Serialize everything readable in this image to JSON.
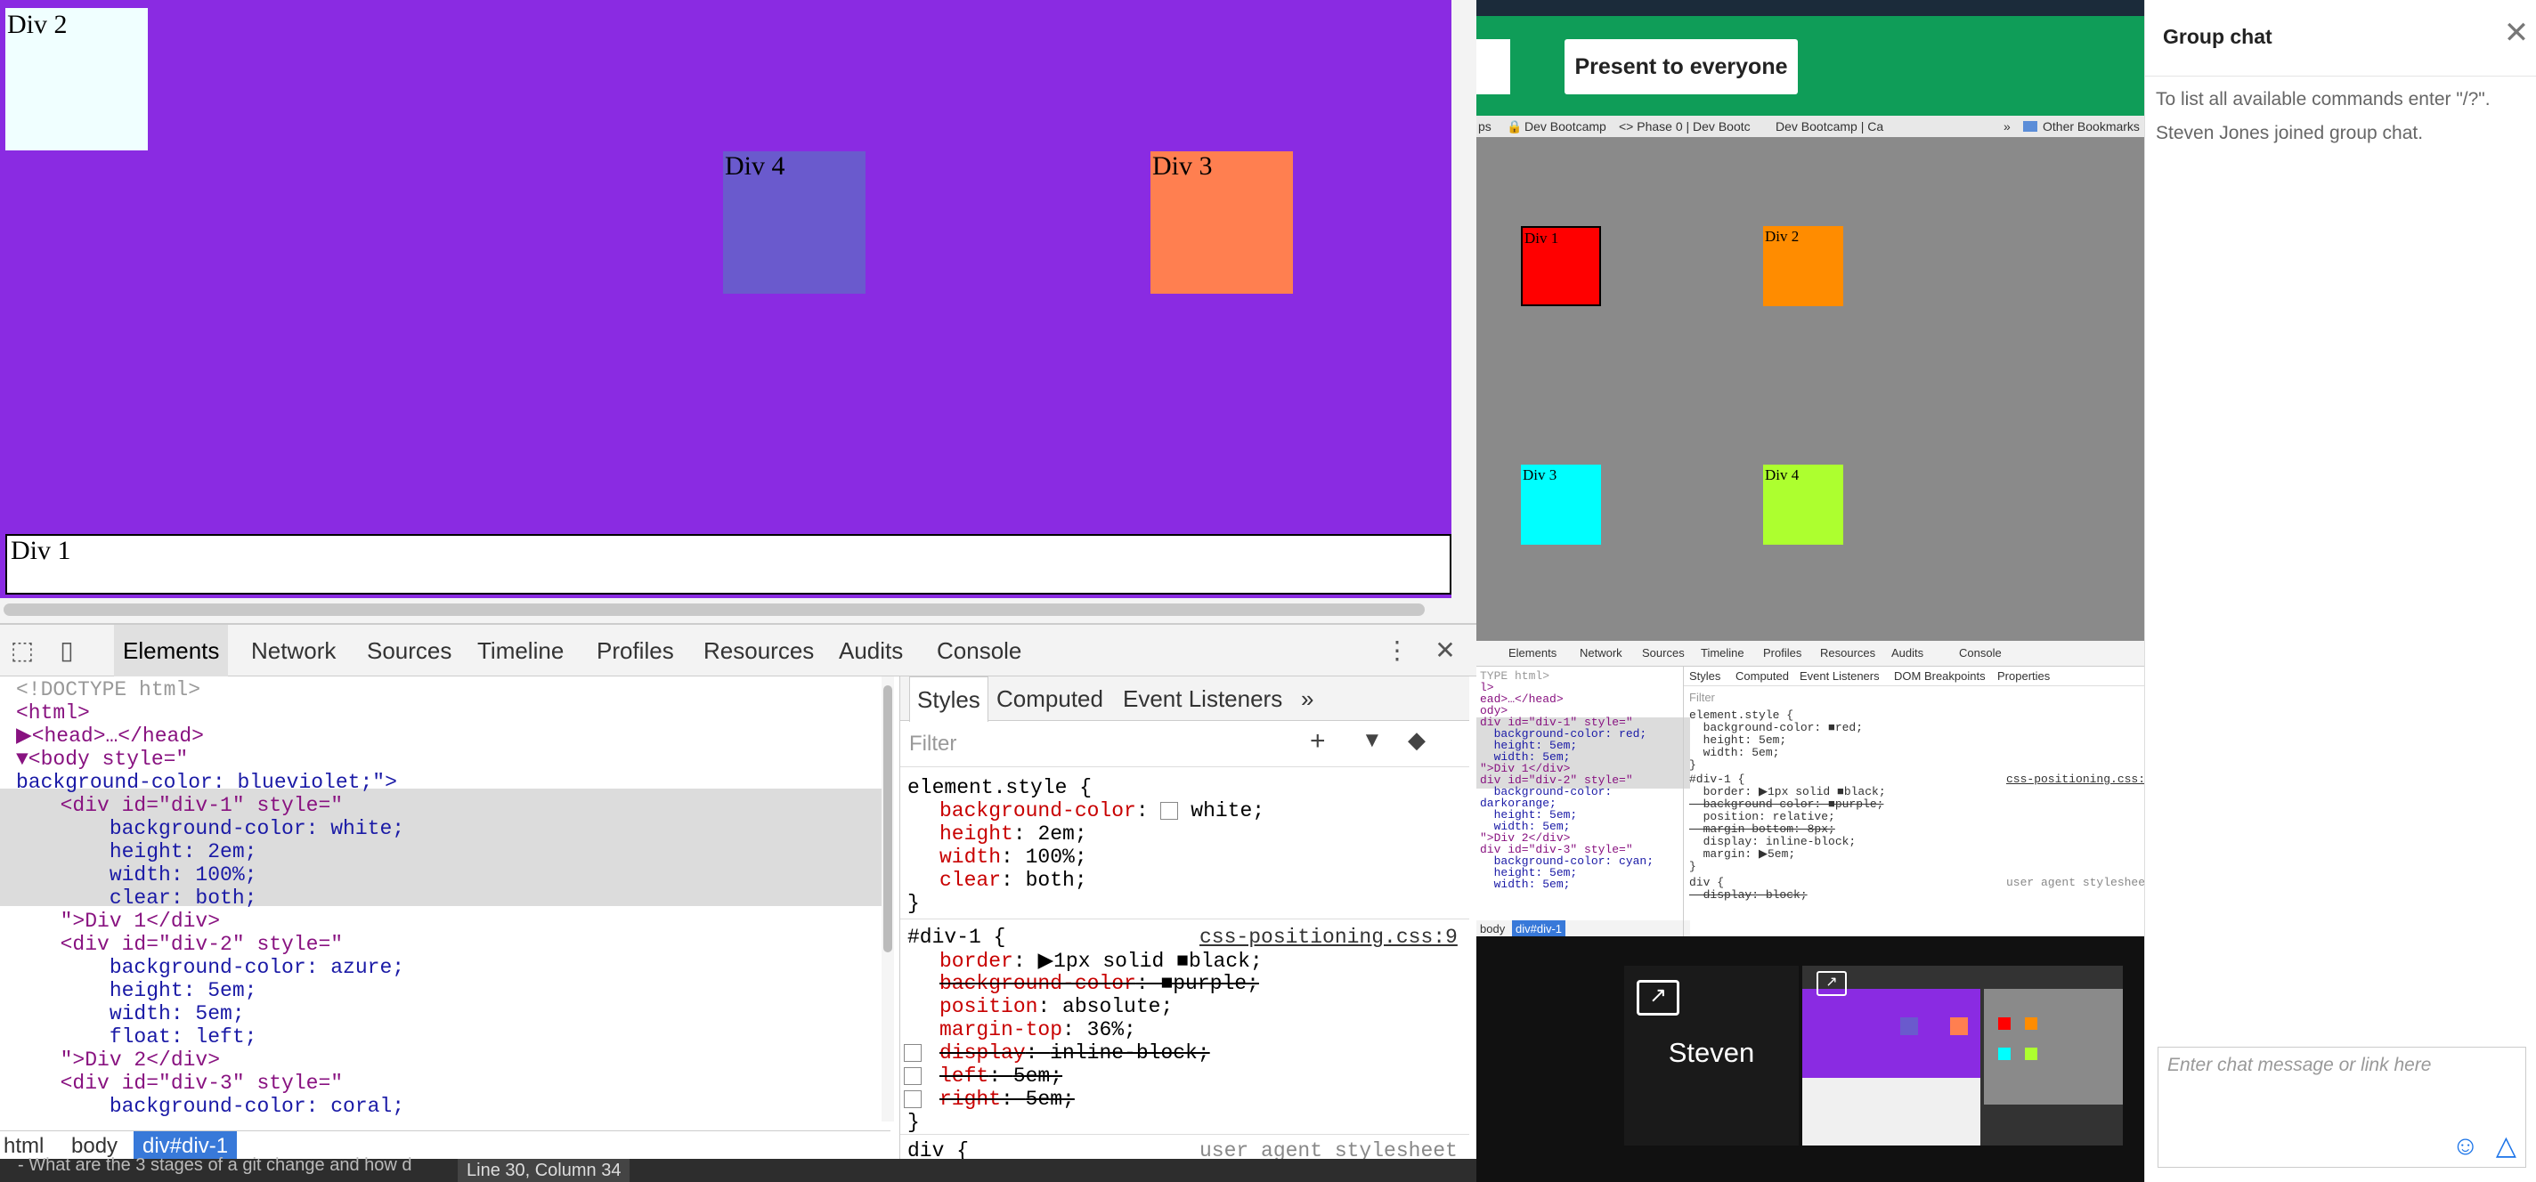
{
  "viewport": {
    "div1": "Div 1",
    "div2": "Div 2",
    "div3": "Div 3",
    "div4": "Div 4",
    "colors": {
      "body": "#8a2be2",
      "div2": "#f0ffff",
      "div3": "#ff7f50",
      "div4": "#6a5acd"
    }
  },
  "devtools": {
    "tabs": [
      "Elements",
      "Network",
      "Sources",
      "Timeline",
      "Profiles",
      "Resources",
      "Audits",
      "Console"
    ],
    "dom_lines": [
      "<!DOCTYPE html>",
      "<html>",
      "▶<head>…</head>",
      "▼<body style=\"",
      "background-color: blueviolet;\">",
      "  <div id=\"div-1\" style=\"",
      "      background-color: white;",
      "      height: 2em;",
      "      width: 100%;",
      "      clear: both;",
      "  \">Div 1</div>",
      "  <div id=\"div-2\" style=\"",
      "      background-color: azure;",
      "      height: 5em;",
      "      width: 5em;",
      "      float: left;",
      "  \">Div 2</div>",
      "  <div id=\"div-3\" style=\"",
      "      background-color: coral;"
    ],
    "styles_tabs": [
      "Styles",
      "Computed",
      "Event Listeners",
      "»"
    ],
    "filter_placeholder": "Filter",
    "element_style_header": "element.style {",
    "element_style": [
      {
        "prop": "background-color",
        "val": "white;"
      },
      {
        "prop": "height",
        "val": "2em;"
      },
      {
        "prop": "width",
        "val": "100%;"
      },
      {
        "prop": "clear",
        "val": "both;"
      }
    ],
    "close_brace": "}",
    "rule_selector": "#div-1 {",
    "rule_source": "css-positioning.css:9",
    "rule_props": [
      {
        "prop": "border",
        "val": "▶1px solid ■black;"
      },
      {
        "prop": "background-color",
        "val": "■purple;"
      },
      {
        "prop": "position",
        "val": "absolute;"
      },
      {
        "prop": "margin-top",
        "val": "36%;"
      },
      {
        "prop": "display",
        "val": "inline-block;"
      },
      {
        "prop": "left",
        "val": "5em;"
      },
      {
        "prop": "right",
        "val": "5em;"
      }
    ],
    "next_rule": "div {",
    "next_rule_source": "user agent stylesheet",
    "breadcrumb": [
      "html",
      "body",
      "div#div-1"
    ],
    "editor_line": "- What are the 3 stages of a git change and how d",
    "editor_status": "Line 30, Column 34"
  },
  "hangout": {
    "present_button": "Present to everyone",
    "bookmarks": [
      "ps",
      "Dev Bootcamp",
      "<> Phase 0 | Dev Bootc",
      "Dev Bootcamp | Ca",
      "»",
      "Other Bookmarks"
    ],
    "shared_divs": [
      "Div 1",
      "Div 2",
      "Div 3",
      "Div 4"
    ],
    "shared_colors": {
      "div1": "#ff0000",
      "div2": "#ff8c00",
      "div3": "#00ffff",
      "div4": "#adff2f",
      "bg": "#8a8a8a"
    },
    "shared_tabs": [
      "Elements",
      "Network",
      "Sources",
      "Timeline",
      "Profiles",
      "Resources",
      "Audits",
      "Console"
    ],
    "shared_style_tabs": [
      "Styles",
      "Computed",
      "Event Listeners",
      "DOM Breakpoints",
      "Properties"
    ],
    "shared_filter": "Filter",
    "shared_dom": [
      "TYPE html>",
      "l>",
      "ead>…</head>",
      "ody>",
      "div id=\"div-1\" style=\"",
      "  background-color: red;",
      "  height: 5em;",
      "  width: 5em;",
      "\">Div 1</div>",
      "div id=\"div-2\" style=\"",
      "  background-color:",
      "darkorange;",
      "  height: 5em;",
      "  width: 5em;",
      "\">Div 2</div>",
      "div id=\"div-3\" style=\"",
      "  background-color: cyan;",
      "  height: 5em;",
      "  width: 5em;"
    ],
    "shared_styles": [
      "element.style {",
      "  background-color: ■red;",
      "  height: 5em;",
      "  width: 5em;",
      "}",
      "#div-1 {",
      "  border: ▶1px solid ■black;",
      "  background-color: ■purple;",
      "  position: relative;",
      "  margin-bottom: 8px;",
      "  display: inline-block;",
      "  margin: ▶5em;",
      "}",
      "div {",
      "  display: block;"
    ],
    "shared_rule_source": "css-positioning.css:9",
    "shared_ua": "user agent stylesheet",
    "shared_breadcrumb": [
      "body",
      "div#div-1"
    ],
    "participant": "Steven"
  },
  "chat": {
    "title": "Group chat",
    "messages": [
      "To list all available commands enter \"/?\".",
      "Steven Jones joined group chat."
    ],
    "input_placeholder": "Enter chat message or link here"
  }
}
